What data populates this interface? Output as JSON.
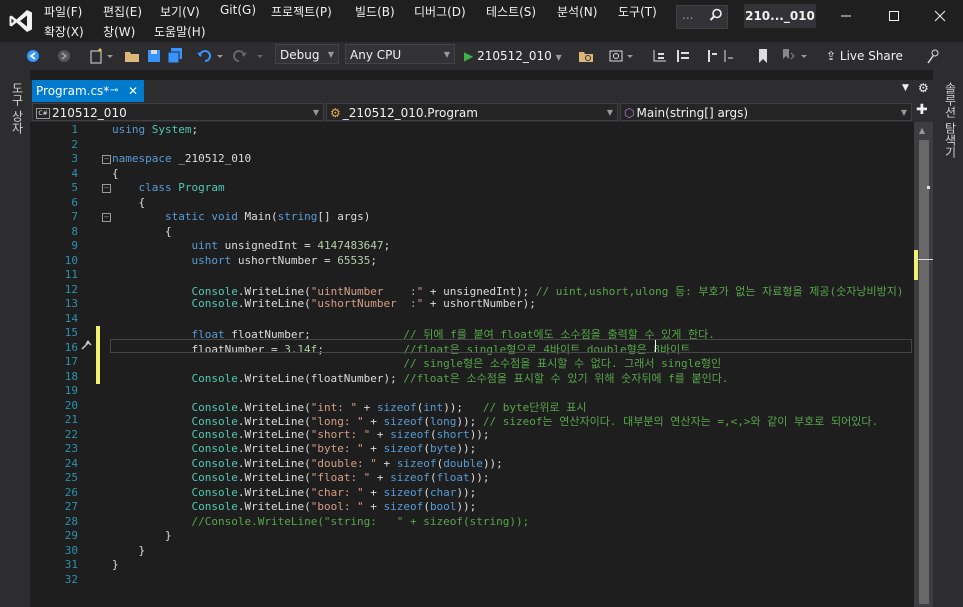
{
  "menu": {
    "row1": [
      "파일(F)",
      "편집(E)",
      "보기(V)",
      "Git(G)",
      "프로젝트(P)",
      "빌드(B)",
      "디버그(D)",
      "테스트(S)",
      "분석(N)",
      "도구(T)"
    ],
    "row2": [
      "확장(X)",
      "창(W)",
      "도움말(H)"
    ]
  },
  "search": {
    "placeholder": "..."
  },
  "solution_name": "210..._010",
  "toolbar": {
    "config": "Debug",
    "platform": "Any CPU",
    "start_label": "210512_010",
    "live_share": "Live Share"
  },
  "left_strip": {
    "label": "도구 상자"
  },
  "right_strip": {
    "label": "솔루션 탐색기"
  },
  "tabs": [
    {
      "label": "Program.cs*"
    }
  ],
  "nav": {
    "project": "210512_010",
    "type": "_210512_010.Program",
    "member": "Main(string[] args)"
  },
  "code_lines": [
    "using System;",
    "",
    "namespace _210512_010",
    "{",
    "    class Program",
    "    {",
    "        static void Main(string[] args)",
    "        {",
    "            uint unsignedInt = 4147483647;",
    "            ushort ushortNumber = 65535;",
    "",
    "            Console.WriteLine(\"uintNumber    :\" + unsignedInt); // uint,ushort,ulong 등: 부호가 없는 자료형을 제공(숫자낭비방지)",
    "            Console.WriteLine(\"ushortNumber  :\" + ushortNumber);",
    "",
    "            float floatNumber;              // 뒤에 f를 붙여 float에도 소수점을 출력할 수 있게 한다.",
    "            floatNumber = 3.14f;            //float은 single형으로 4바이트 double형은 8바이트",
    "                                            // single형은 소수점을 표시할 수 없다. 그래서 single형인",
    "            Console.WriteLine(floatNumber); //float은 소수점을 표시할 수 있기 위해 숫자뒤에 f를 붙인다.",
    "",
    "            Console.WriteLine(\"int: \" + sizeof(int));   // byte단위로 표시",
    "            Console.WriteLine(\"long: \" + sizeof(long)); // sizeof는 연산자이다. 대부분의 연산자는 =,<,>와 같이 부호로 되어있다.",
    "            Console.WriteLine(\"short: \" + sizeof(short));",
    "            Console.WriteLine(\"byte: \" + sizeof(byte));",
    "            Console.WriteLine(\"double: \" + sizeof(double));",
    "            Console.WriteLine(\"float: \" + sizeof(float));",
    "            Console.WriteLine(\"char: \" + sizeof(char));",
    "            Console.WriteLine(\"bool: \" + sizeof(bool));",
    "            //Console.WriteLine(\"string:   \" + sizeof(string));",
    "        }",
    "    }",
    "}",
    ""
  ],
  "colors": {
    "accent": "#007acc",
    "keyword": "#569cd6",
    "type": "#4ec9b0",
    "string": "#d69d85",
    "comment": "#57a64a",
    "line_number": "#2b91af",
    "change_marker": "#f1f171"
  }
}
